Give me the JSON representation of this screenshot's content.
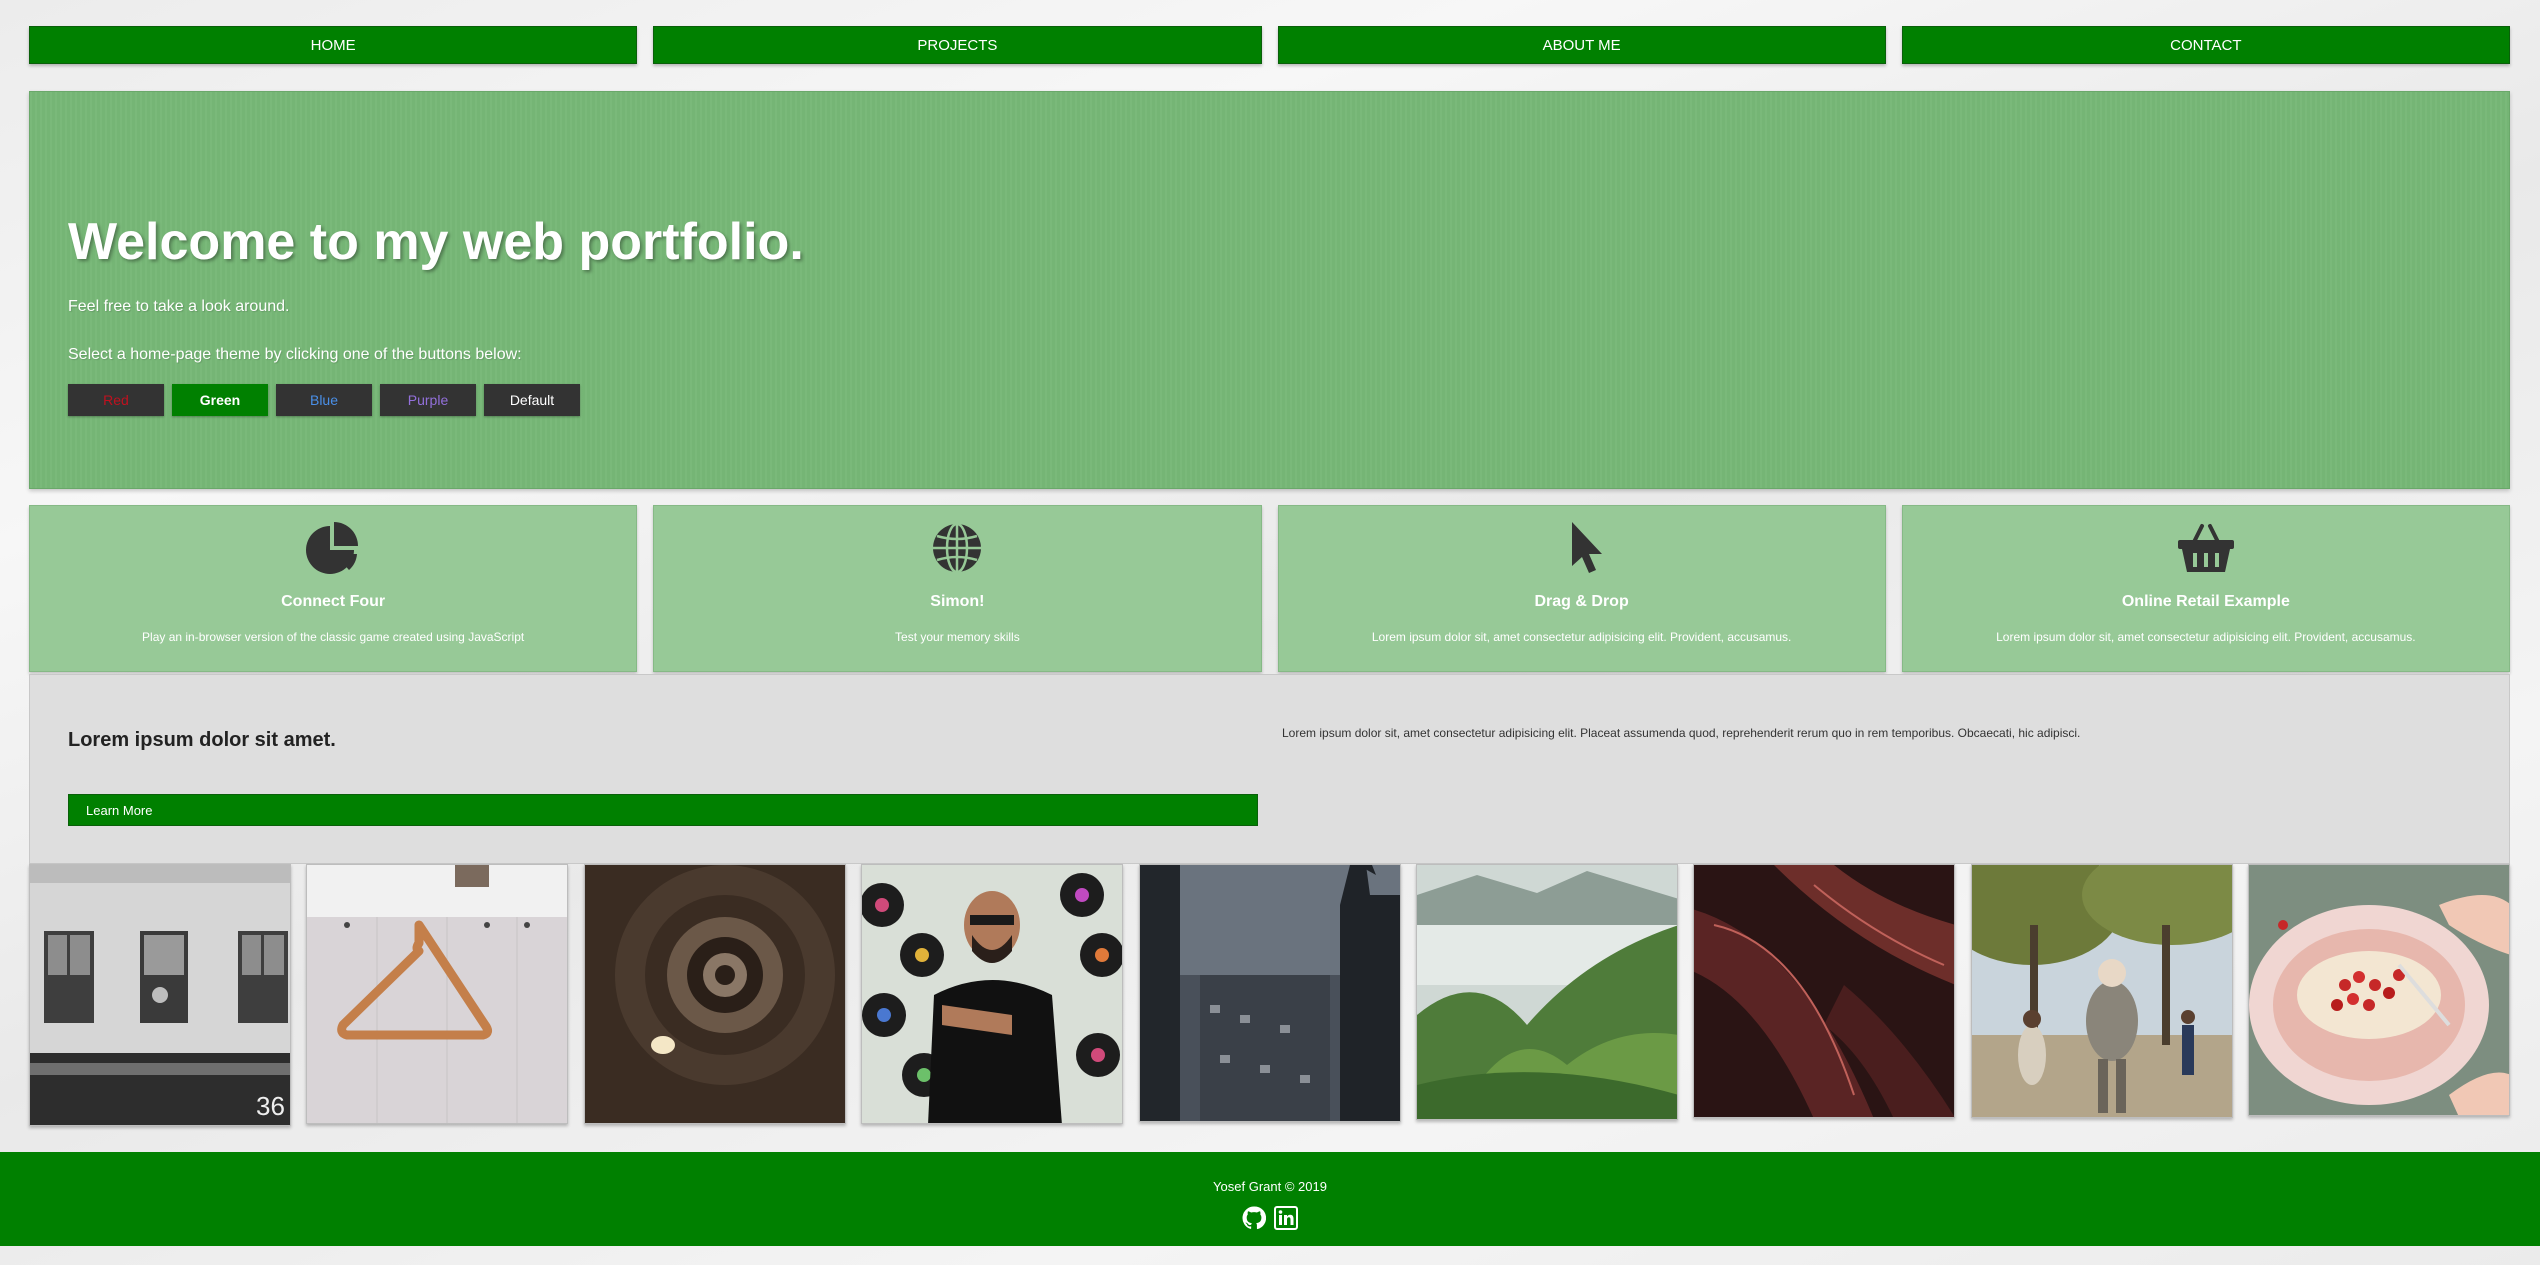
{
  "nav": {
    "items": [
      {
        "label": "HOME"
      },
      {
        "label": "PROJECTS"
      },
      {
        "label": "ABOUT ME"
      },
      {
        "label": "CONTACT"
      }
    ]
  },
  "hero": {
    "title": "Welcome to my web portfolio.",
    "subtitle": "Feel free to take a look around.",
    "theme_prompt": "Select a home-page theme by clicking one of the buttons below:",
    "themes": [
      {
        "label": "Red",
        "text_color": "#c0111f",
        "bg": "#333333"
      },
      {
        "label": "Green",
        "text_color": "#ffffff",
        "bg": "#008000",
        "selected": true
      },
      {
        "label": "Blue",
        "text_color": "#4a8fe7",
        "bg": "#333333"
      },
      {
        "label": "Purple",
        "text_color": "#9370db",
        "bg": "#333333"
      },
      {
        "label": "Default",
        "text_color": "#ffffff",
        "bg": "#333333"
      }
    ]
  },
  "projects": [
    {
      "icon": "pie-chart-icon",
      "title": "Connect Four",
      "desc": "Play an in-browser version of the classic game created using JavaScript"
    },
    {
      "icon": "globe-icon",
      "title": "Simon!",
      "desc": "Test your memory skills"
    },
    {
      "icon": "cursor-icon",
      "title": "Drag & Drop",
      "desc": "Lorem ipsum dolor sit, amet consectetur adipisicing elit. Provident, accusamus."
    },
    {
      "icon": "basket-icon",
      "title": "Online Retail Example",
      "desc": "Lorem ipsum dolor sit, amet consectetur adipisicing elit. Provident, accusamus."
    }
  ],
  "info": {
    "heading": "Lorem ipsum dolor sit amet.",
    "button_label": "Learn More",
    "paragraph": "Lorem ipsum dolor sit, amet consectetur adipisicing elit. Placeat assumenda quod, reprehenderit rerum quo in rem temporibus. Obcaecati, hic adipisci."
  },
  "gallery": [
    {
      "name": "building-window-photo"
    },
    {
      "name": "coat-hanger-photo"
    },
    {
      "name": "spiral-staircase-photo"
    },
    {
      "name": "vinyl-records-man-photo"
    },
    {
      "name": "city-tower-photo"
    },
    {
      "name": "green-hills-photo"
    },
    {
      "name": "dark-leaves-photo"
    },
    {
      "name": "park-people-photo"
    },
    {
      "name": "pancake-dessert-photo"
    }
  ],
  "footer": {
    "credit": "Yosef Grant © 2019",
    "social": [
      {
        "icon": "github-icon"
      },
      {
        "icon": "linkedin-icon"
      }
    ]
  },
  "colors": {
    "accent": "#008000",
    "hero_bg": "#77b877",
    "card_bg": "#97c997",
    "info_bg": "#dedede",
    "dark": "#333333"
  }
}
